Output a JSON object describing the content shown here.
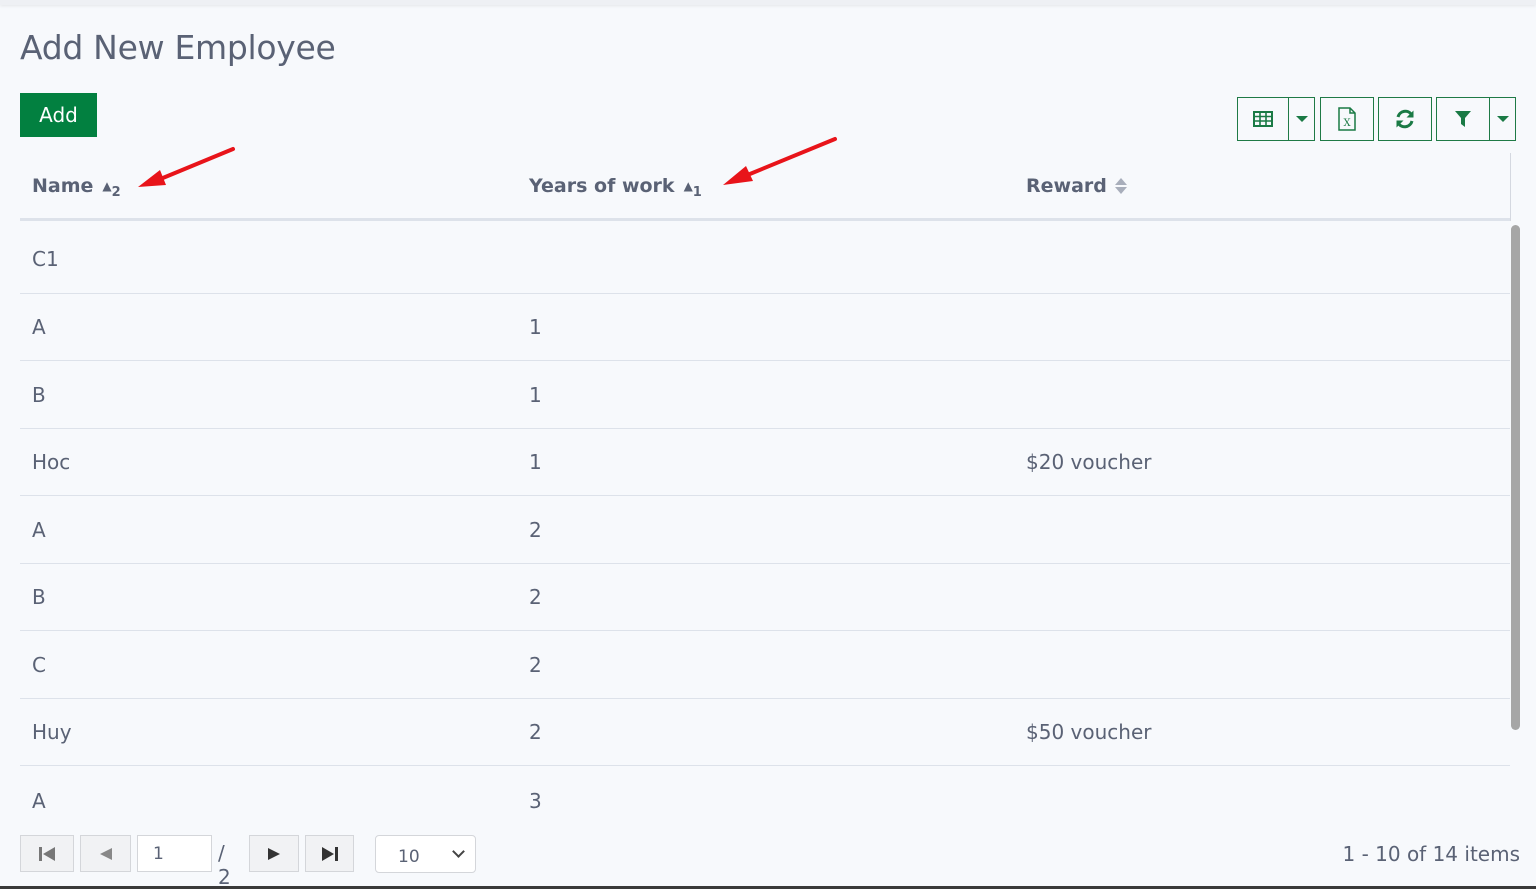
{
  "page": {
    "title": "Add New Employee",
    "add_button_label": "Add"
  },
  "toolbar": {
    "buttons": [
      {
        "name": "column-chooser",
        "icon": "table-icon"
      },
      {
        "name": "column-chooser-dropdown",
        "icon": "caret-down-icon"
      },
      {
        "name": "export-excel",
        "icon": "excel-file-icon"
      },
      {
        "name": "refresh",
        "icon": "refresh-icon"
      },
      {
        "name": "filter",
        "icon": "filter-icon"
      },
      {
        "name": "filter-dropdown",
        "icon": "caret-down-icon"
      }
    ],
    "accent_color": "#1a7a45"
  },
  "table": {
    "columns": [
      {
        "label": "Name",
        "sort": "ascending",
        "sort_order": "2"
      },
      {
        "label": "Years of work",
        "sort": "ascending",
        "sort_order": "1"
      },
      {
        "label": "Reward",
        "sort": "none"
      }
    ],
    "rows": [
      [
        "C1",
        "",
        ""
      ],
      [
        "A",
        "1",
        ""
      ],
      [
        "B",
        "1",
        ""
      ],
      [
        "Hoc",
        "1",
        "$20 voucher"
      ],
      [
        "A",
        "2",
        ""
      ],
      [
        "B",
        "2",
        ""
      ],
      [
        "C",
        "2",
        ""
      ],
      [
        "Huy",
        "2",
        "$50 voucher"
      ],
      [
        "A",
        "3",
        ""
      ]
    ]
  },
  "pager": {
    "current_page": "1",
    "total_pages_label": "/ 2",
    "page_size": "10",
    "info": "1 - 10 of 14 items"
  },
  "colors": {
    "primary_green": "#028040",
    "text": "#5a6275",
    "background": "#f7f9fc",
    "annotation_red": "#e8141a"
  }
}
